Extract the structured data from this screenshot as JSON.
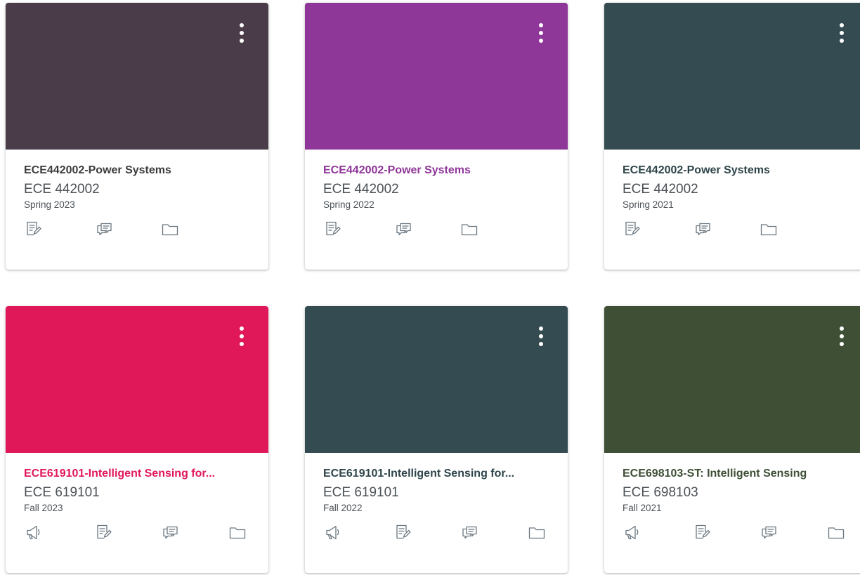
{
  "colors": {
    "text_dark": "#2d3b45",
    "text_muted": "#4b5157",
    "icon_gray": "#6b7780"
  },
  "cards": [
    {
      "title": "ECE442002-Power Systems",
      "code": "ECE 442002",
      "term": "Spring 2023",
      "hero_color": "#4a3c49",
      "title_color": "#3d3d3d",
      "actions": [
        "assignments-icon",
        "discussions-icon",
        "files-icon"
      ]
    },
    {
      "title": "ECE442002-Power Systems",
      "code": "ECE 442002",
      "term": "Spring 2022",
      "hero_color": "#8f3699",
      "title_color": "#8f3699",
      "actions": [
        "assignments-icon",
        "discussions-icon",
        "files-icon"
      ]
    },
    {
      "title": "ECE442002-Power Systems",
      "code": "ECE 442002",
      "term": "Spring 2021",
      "hero_color": "#334b51",
      "title_color": "#2f454b",
      "actions": [
        "assignments-icon",
        "discussions-icon",
        "files-icon"
      ]
    },
    {
      "title": "ECE619101-Intelligent Sensing for...",
      "code": "ECE 619101",
      "term": "Fall 2023",
      "hero_color": "#e0185a",
      "title_color": "#e0185a",
      "actions": [
        "announcements-icon",
        "assignments-icon",
        "discussions-icon",
        "files-icon"
      ]
    },
    {
      "title": "ECE619101-Intelligent Sensing for...",
      "code": "ECE 619101",
      "term": "Fall 2022",
      "hero_color": "#334b51",
      "title_color": "#2f454b",
      "actions": [
        "announcements-icon",
        "assignments-icon",
        "discussions-icon",
        "files-icon"
      ]
    },
    {
      "title": "ECE698103-ST: Intelligent Sensing",
      "code": "ECE 698103",
      "term": "Fall 2021",
      "hero_color": "#3e4f36",
      "title_color": "#3e4f36",
      "actions": [
        "announcements-icon",
        "assignments-icon",
        "discussions-icon",
        "files-icon"
      ]
    }
  ]
}
